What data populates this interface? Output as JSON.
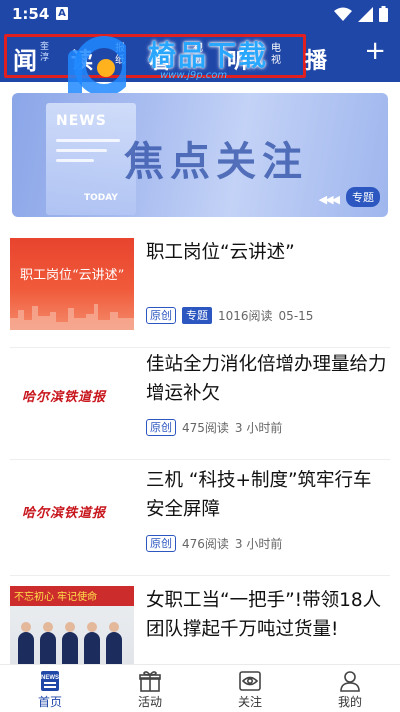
{
  "status_bar": {
    "time": "1:54",
    "notification_letter": "A"
  },
  "header": {
    "logo_char": "闻",
    "logo_sub": "奎淳",
    "tabs": [
      {
        "label": "读"
      },
      {
        "label": "看",
        "small": "报纸"
      },
      {
        "label": "听",
        "small": "视频"
      },
      {
        "label": "视",
        "small": "电视"
      },
      {
        "label": "播"
      }
    ],
    "watermark_text": "椅品下载",
    "watermark_url": "www.j9p.com",
    "add_symbol": "+"
  },
  "banner": {
    "paper_news": "NEWS",
    "paper_today": "TODAY",
    "title": "焦点关注",
    "arrows": "◀◀◀",
    "tag": "专题"
  },
  "news": [
    {
      "title": "职工岗位“云讲述”",
      "thumb_text": "职工岗位“云讲述”",
      "origin": "原创",
      "topic": "专题",
      "reads": "1016阅读",
      "time": "05-15"
    },
    {
      "title": "佳站全力消化倍增办理量给力增运补欠",
      "thumb_text": "哈尔滨铁道报",
      "origin": "原创",
      "reads": "475阅读",
      "time": "3 小时前"
    },
    {
      "title": "三机 “科技+制度”筑牢行车安全屏障",
      "thumb_text": "哈尔滨铁道报",
      "origin": "原创",
      "reads": "476阅读",
      "time": "3 小时前"
    },
    {
      "title": "女职工当“一把手”!带领18人团队撑起千万吨过货量!",
      "thumb_text": "不忘初心 牢记使命"
    }
  ],
  "bottom_nav": [
    {
      "label": "首页",
      "icon": "home-news-icon",
      "active": true
    },
    {
      "label": "活动",
      "icon": "gift-icon"
    },
    {
      "label": "关注",
      "icon": "eye-icon"
    },
    {
      "label": "我的",
      "icon": "person-icon"
    }
  ],
  "colors": {
    "brand_blue": "#1f47a8",
    "accent_blue": "#2d57c0",
    "highlight_red": "#e02020"
  }
}
